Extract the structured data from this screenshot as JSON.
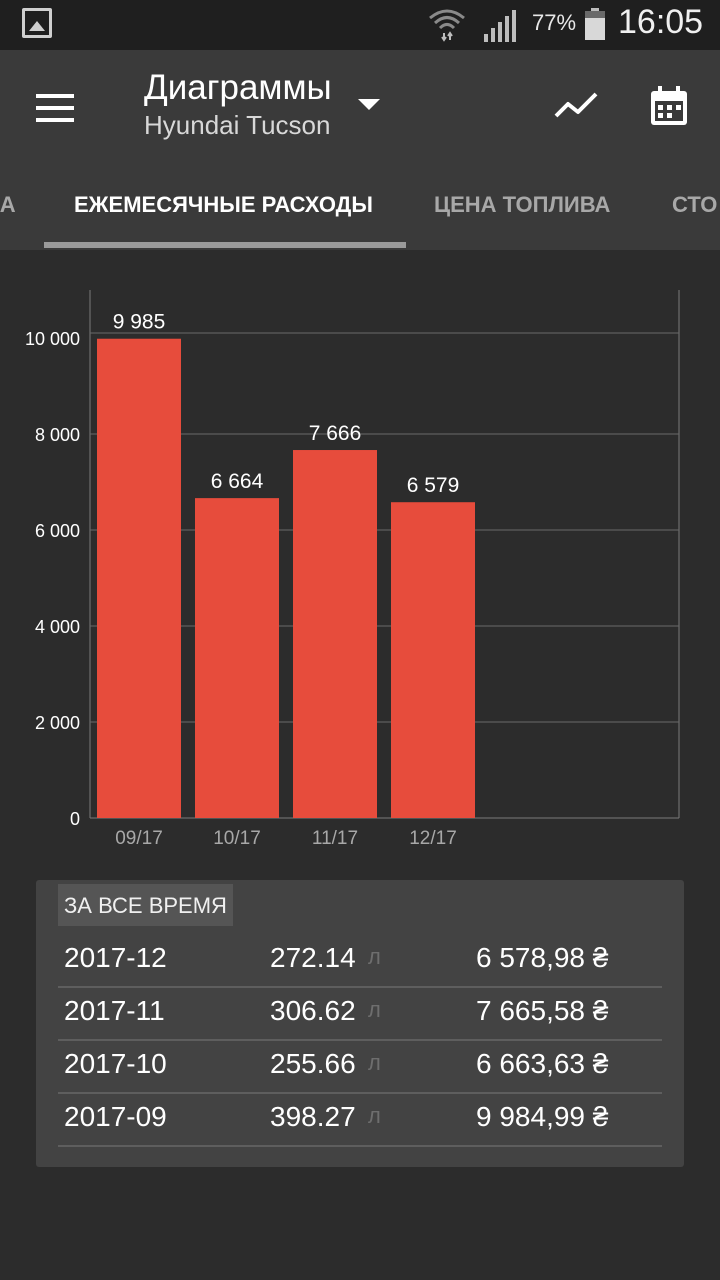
{
  "status_bar": {
    "battery_percent": "77%",
    "time": "16:05"
  },
  "app_bar": {
    "title": "Диаграммы",
    "subtitle": "Hyundai Tucson"
  },
  "tabs": [
    {
      "label": "ЗА",
      "active": false
    },
    {
      "label": "ЕЖЕМЕСЯЧНЫЕ РАСХОДЫ",
      "active": true
    },
    {
      "label": "ЦЕНА ТОПЛИВА",
      "active": false
    },
    {
      "label": "СТО",
      "active": false
    }
  ],
  "chart_data": {
    "type": "bar",
    "categories": [
      "09/17",
      "10/17",
      "11/17",
      "12/17"
    ],
    "values": [
      9985,
      6664,
      7666,
      6579
    ],
    "value_labels": [
      "9 985",
      "6 664",
      "7 666",
      "6 579"
    ],
    "y_ticks": [
      0,
      2000,
      4000,
      6000,
      8000,
      10000
    ],
    "y_tick_labels": [
      "0",
      "2 000",
      "4 000",
      "6 000",
      "8 000",
      "10 000"
    ],
    "ylim": [
      0,
      10000
    ],
    "bar_color": "#e74c3c",
    "grid": true
  },
  "summary": {
    "header": "ЗА ВСЕ ВРЕМЯ",
    "rows": [
      {
        "month": "2017-12",
        "volume": "272.14",
        "unit": "л",
        "cost": "6 578,98 ₴"
      },
      {
        "month": "2017-11",
        "volume": "306.62",
        "unit": "л",
        "cost": "7 665,58 ₴"
      },
      {
        "month": "2017-10",
        "volume": "255.66",
        "unit": "л",
        "cost": "6 663,63 ₴"
      },
      {
        "month": "2017-09",
        "volume": "398.27",
        "unit": "л",
        "cost": "9 984,99 ₴"
      }
    ]
  },
  "colors": {
    "accent_bar": "#e74c3c",
    "app_bar": "#3a3a3a",
    "background": "#2c2c2c"
  },
  "icons": [
    "gallery-icon",
    "wifi-icon",
    "signal-icon",
    "battery-icon",
    "menu-icon",
    "dropdown-icon",
    "trend-icon",
    "calendar-icon"
  ]
}
